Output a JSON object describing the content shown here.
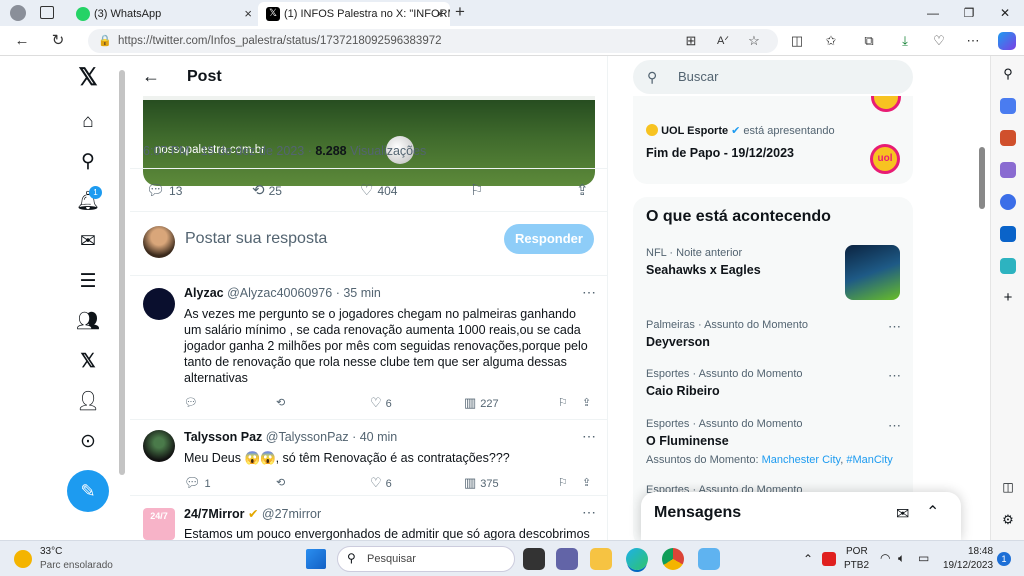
{
  "browser": {
    "tabs": [
      {
        "title": "(3) WhatsApp",
        "close": "×"
      },
      {
        "title": "(1) INFOS Palestra no X: \"INFORM",
        "close": "×"
      }
    ],
    "new_tab": "+",
    "url_domain": "https://twitter.com",
    "url_path": "/Infos_palestra/status/1737218092596383972"
  },
  "post": {
    "header_title": "Post",
    "media_caption": "nossopalestra.com.br",
    "time": "6:07 PM · 19 de dez de 2023 · ",
    "views": "8.288",
    "views_label": " Visualizações",
    "replies": "13",
    "reposts": "25",
    "likes": "404",
    "reply_placeholder": "Postar sua resposta",
    "reply_button": "Responder"
  },
  "replies": [
    {
      "name": "Alyzac",
      "handle": "@Alyzac40060976 · 35 min",
      "text": "As vezes me pergunto se o jogadores chegam no palmeiras ganhando um salário mínimo , se cada renovação aumenta 1000 reais,ou se cada jogador ganha 2 milhões por mês com seguidas renovações,porque pelo tanto de renovação que rola nesse clube tem que ser alguma dessas alternativas",
      "likes": "6",
      "views": "227"
    },
    {
      "name": "Talysson Paz",
      "handle": "@TalyssonPaz · 40 min",
      "text": "Meu Deus 😱😱, só têm Renovação é as contratações???",
      "replies": "1",
      "likes": "6",
      "views": "375"
    },
    {
      "name": "24/7Mirror",
      "handle": "@27mirror",
      "text": "Estamos um pouco envergonhados de admitir que só agora descobrimos"
    }
  ],
  "sidebar": {
    "search_placeholder": "Buscar",
    "promo": {
      "brand": "UOL Esporte",
      "presenting": " está apresentando",
      "title": "Fim de Papo - 19/12/2023",
      "logo": "uol"
    },
    "trending_title": "O que está acontecendo",
    "trends": [
      {
        "meta": "NFL · Noite anterior",
        "title": "Seahawks x Eagles"
      },
      {
        "meta": "Palmeiras · Assunto do Momento",
        "title": "Deyverson"
      },
      {
        "meta": "Esportes · Assunto do Momento",
        "title": "Caio Ribeiro"
      },
      {
        "meta": "Esportes · Assunto do Momento",
        "title": "O Fluminense",
        "sub_label": "Assuntos do Momento: ",
        "sub_link1": "Manchester City",
        "sub_sep": ", ",
        "sub_link2": "#ManCity"
      },
      {
        "meta": "Esportes · Assunto do Momento"
      }
    ],
    "messages_title": "Mensagens"
  },
  "taskbar": {
    "weather_temp": "33°C",
    "weather_desc": "Parc ensolarado",
    "search_label": "Pesquisar",
    "lang1": "POR",
    "lang2": "PTB2",
    "time": "18:48",
    "date": "19/12/2023",
    "notif_count": "1"
  },
  "colors": {
    "accent": "#1d9bf0",
    "reply_button": "#8ecdf8"
  }
}
